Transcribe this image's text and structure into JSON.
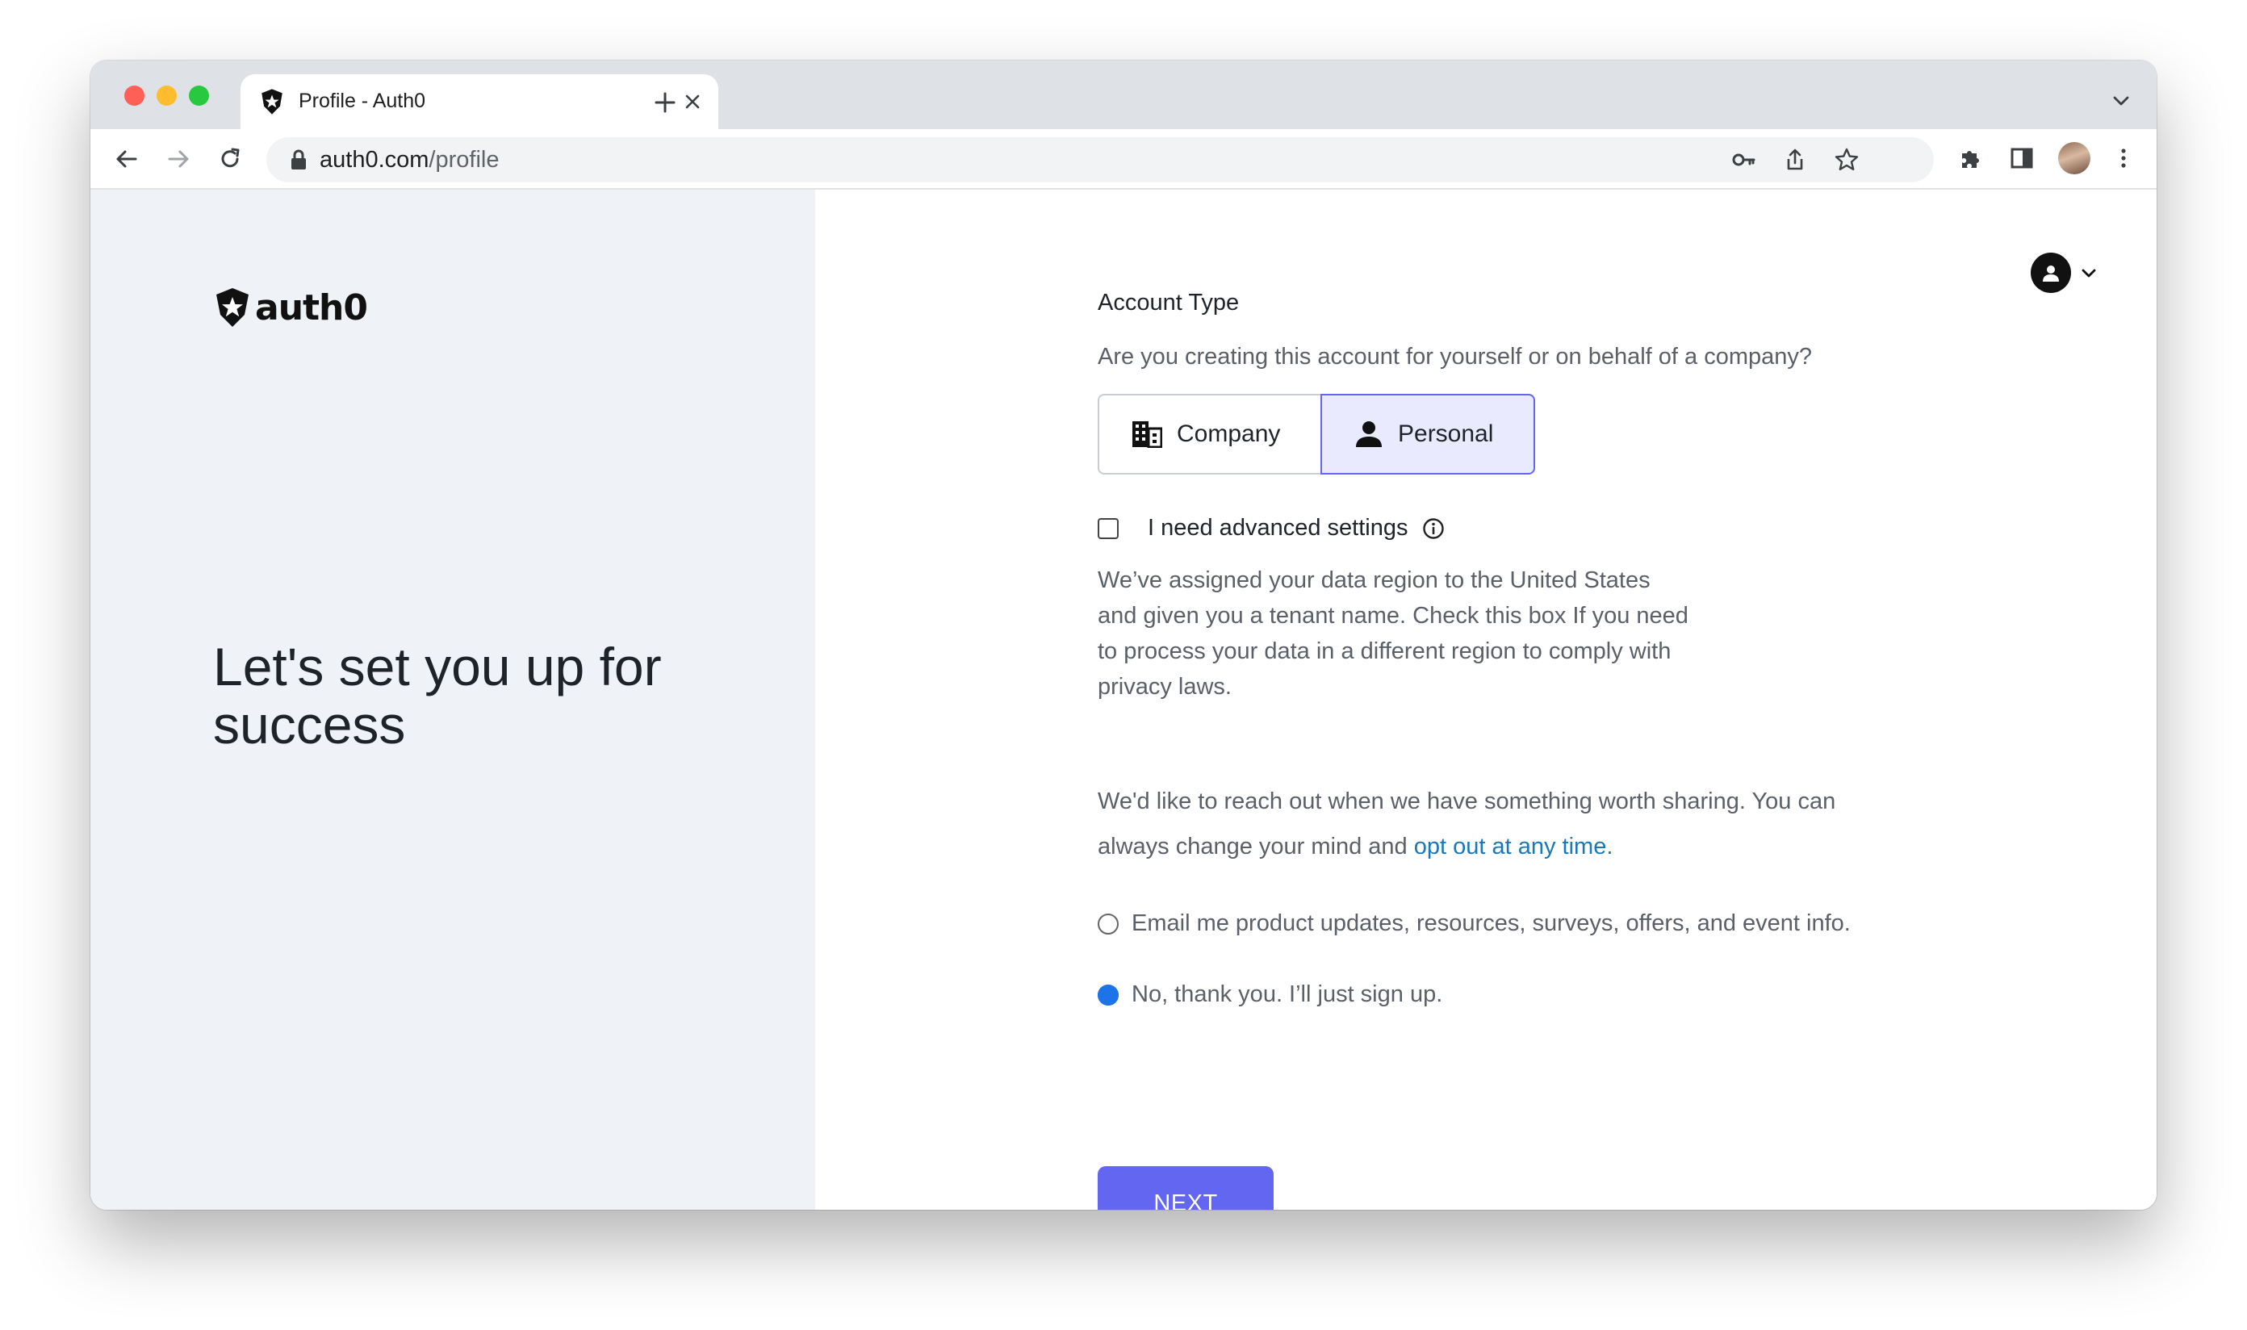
{
  "browser": {
    "tab_title": "Profile - Auth0",
    "url_host": "auth0.com",
    "url_path": "/profile"
  },
  "brand": {
    "logo_text": "auth0",
    "accent_color": "#6366f1",
    "link_color": "#1a78b8"
  },
  "left": {
    "headline": "Let's set you up for success"
  },
  "form": {
    "account_type_label": "Account Type",
    "account_question": "Are you creating this account for yourself or on behalf of a company?",
    "options": [
      {
        "label": "Company",
        "icon": "building-icon",
        "selected": false
      },
      {
        "label": "Personal",
        "icon": "person-icon",
        "selected": true
      }
    ],
    "advanced_label": "I need advanced settings",
    "advanced_checked": false,
    "advanced_desc": "We’ve assigned your data region to the United States and given you a tenant name. Check this box If you need to process your data in a different region to comply with privacy laws.",
    "reach_text": "We'd like to reach out when we have something worth sharing. You can always change your mind and ",
    "opt_out_link": "opt out at any time.",
    "radio_email": "Email me product updates, resources, surveys, offers, and event info.",
    "radio_no": "No, thank you. I’ll just sign up.",
    "selected_radio": "no",
    "next_label": "NEXT"
  }
}
